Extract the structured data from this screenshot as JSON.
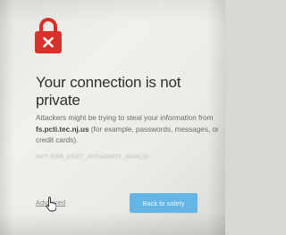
{
  "interstitial": {
    "icon": "lock-error-icon",
    "icon_color": "#d9302c",
    "heading": "Your connection is not private",
    "description": {
      "before": "Attackers might be trying to steal your information from ",
      "domain": "fs.pcti.tec.nj.us",
      "after": " (for example, passwords, messages, or credit cards)."
    },
    "error_code": "NET::ERR_CERT_AUTHORITY_INVALID",
    "advanced_link": "Advanced",
    "back_button": "Back to safety",
    "accent_color": "#63b6e5"
  }
}
